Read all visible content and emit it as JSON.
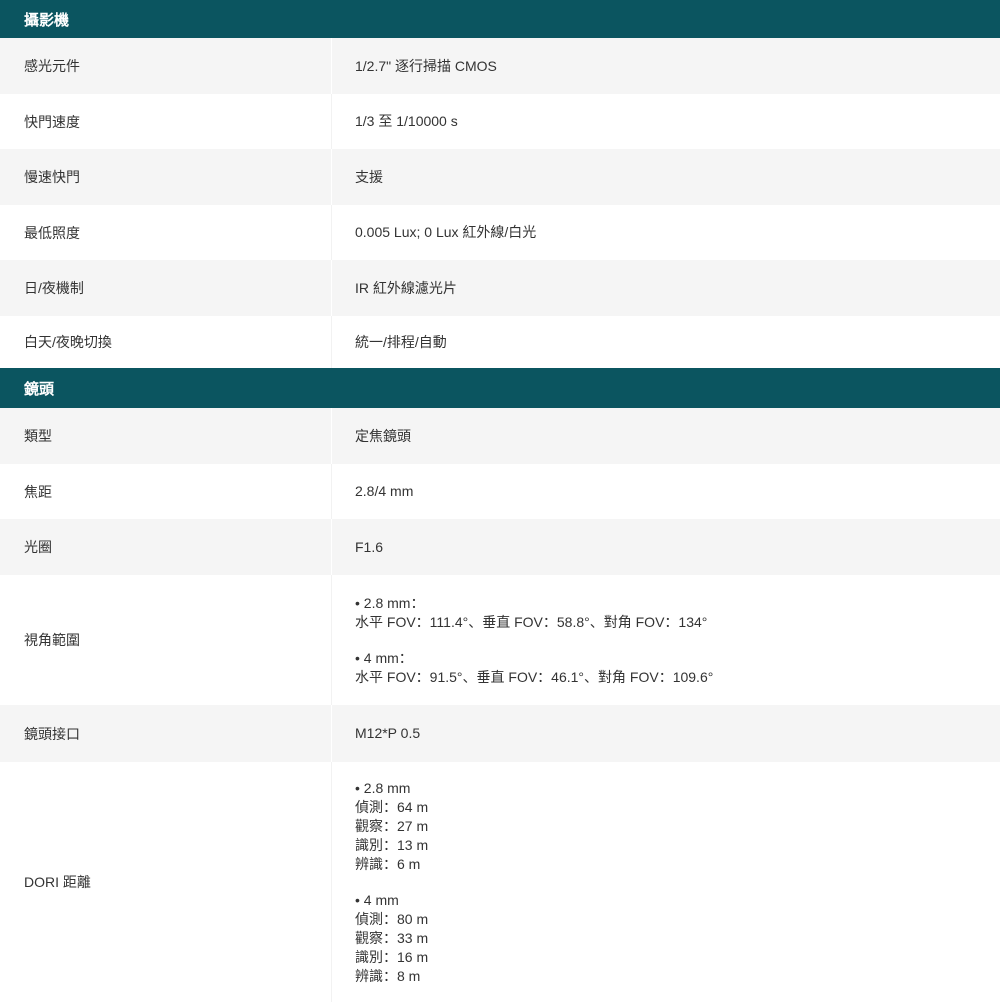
{
  "sections": [
    {
      "title": "攝影機",
      "rows": [
        {
          "label": "感光元件",
          "value": "1/2.7\" 逐行掃描 CMOS"
        },
        {
          "label": "快門速度",
          "value": "1/3 至 1/10000 s"
        },
        {
          "label": "慢速快門",
          "value": "支援"
        },
        {
          "label": "最低照度",
          "value": "0.005 Lux; 0 Lux 紅外線/白光"
        },
        {
          "label": "日/夜機制",
          "value": "IR 紅外線濾光片"
        },
        {
          "label": "白天/夜晚切換",
          "value": "統一/排程/自動"
        }
      ]
    },
    {
      "title": "鏡頭",
      "rows": [
        {
          "label": "類型",
          "value": "定焦鏡頭"
        },
        {
          "label": "焦距",
          "value": "2.8/4 mm"
        },
        {
          "label": "光圈",
          "value": "F1.6"
        },
        {
          "label": "視角範圍",
          "groups": [
            [
              "• 2.8 mm：",
              "水平 FOV：111.4°、垂直 FOV：58.8°、對角 FOV：134°"
            ],
            [
              "• 4 mm：",
              "水平 FOV：91.5°、垂直 FOV：46.1°、對角 FOV：109.6°"
            ]
          ]
        },
        {
          "label": "鏡頭接口",
          "value": "M12*P 0.5"
        },
        {
          "label": "DORI 距離",
          "groups": [
            [
              "• 2.8 mm",
              "偵測：64 m",
              "觀察：27 m",
              "識別：13 m",
              "辨識：6 m"
            ],
            [
              "• 4 mm",
              "偵測：80 m",
              "觀察：33 m",
              "識別：16 m",
              "辨識：8 m"
            ]
          ]
        }
      ]
    }
  ]
}
